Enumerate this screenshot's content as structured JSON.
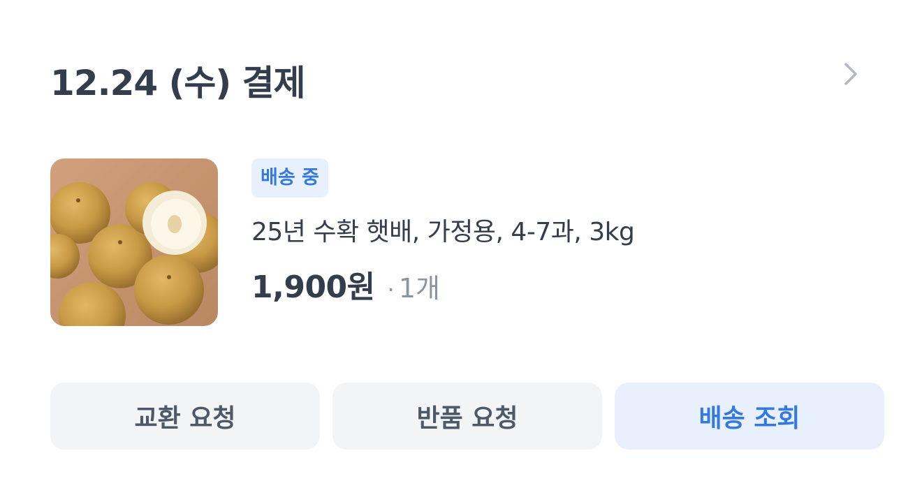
{
  "order": {
    "date_title": "12.24 (수) 결제",
    "chevron_icon": "chevron-right-icon"
  },
  "product": {
    "image_alt": "Asian pears",
    "status_badge": "배송 중",
    "name": "25년 수확 햇배, 가정용, 4-7과, 3kg",
    "price": "1,900원",
    "separator": "·",
    "quantity": "1개"
  },
  "actions": {
    "exchange": "교환 요청",
    "return": "반품 요청",
    "track": "배송 조회"
  },
  "colors": {
    "title": "#333d4b",
    "accent": "#3479e0",
    "accent_bg": "#e8f0fd",
    "button_bg": "#f2f4f6",
    "muted": "#8b95a1"
  }
}
